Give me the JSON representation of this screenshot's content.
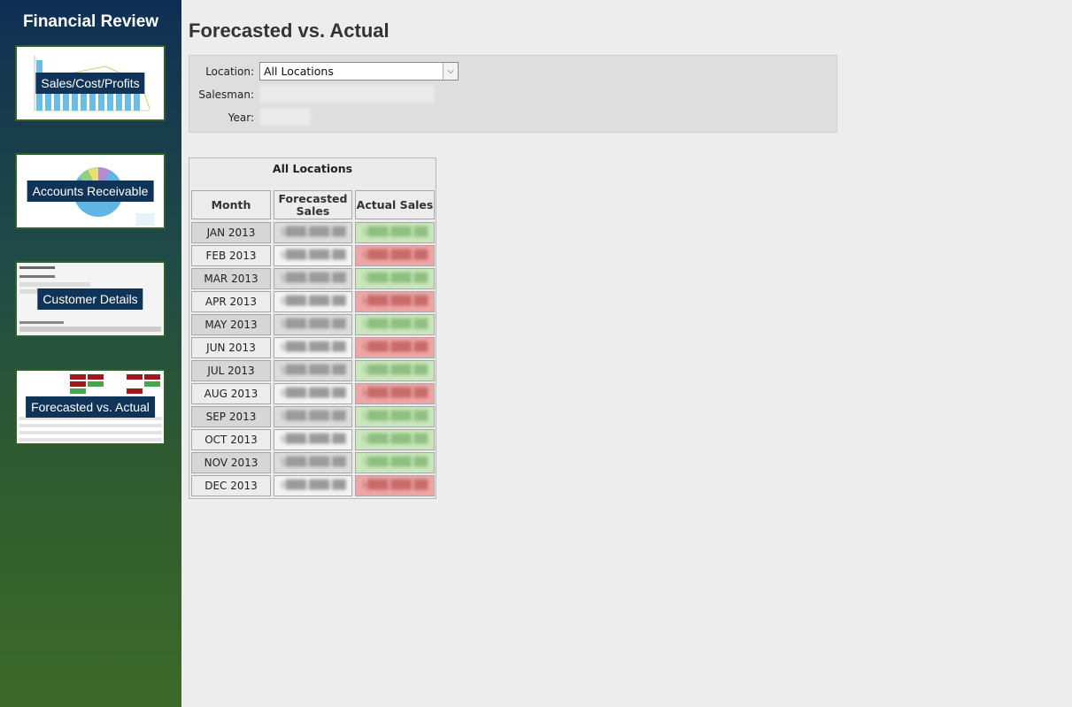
{
  "sidebar": {
    "title": "Financial Review",
    "items": [
      {
        "label": "Sales/Cost/Profits"
      },
      {
        "label": "Accounts Receivable"
      },
      {
        "label": "Customer Details"
      },
      {
        "label": "Forecasted vs. Actual"
      }
    ]
  },
  "page": {
    "title": "Forecasted vs. Actual"
  },
  "filters": {
    "location_label": "Location:",
    "location_value": "All Locations",
    "salesman_label": "Salesman:",
    "year_label": "Year:"
  },
  "table": {
    "title": "All Locations",
    "headers": {
      "month": "Month",
      "forecasted": "Forecasted Sales",
      "actual": "Actual Sales"
    },
    "months": [
      "JAN 2013",
      "FEB 2013",
      "MAR 2013",
      "APR 2013",
      "MAY 2013",
      "JUN 2013",
      "JUL 2013",
      "AUG 2013",
      "SEP 2013",
      "OCT 2013",
      "NOV 2013",
      "DEC 2013"
    ],
    "actual_status": [
      "over",
      "under",
      "over",
      "under",
      "over",
      "under",
      "over",
      "under",
      "over",
      "over",
      "over",
      "under"
    ]
  },
  "colors": {
    "month_shaded": "#d6d6d6",
    "month_plain": "#ececec",
    "actual_over": "#c9e6bd",
    "actual_under": "#eda5a5",
    "sidebar_label_bg": "#0f3457"
  }
}
